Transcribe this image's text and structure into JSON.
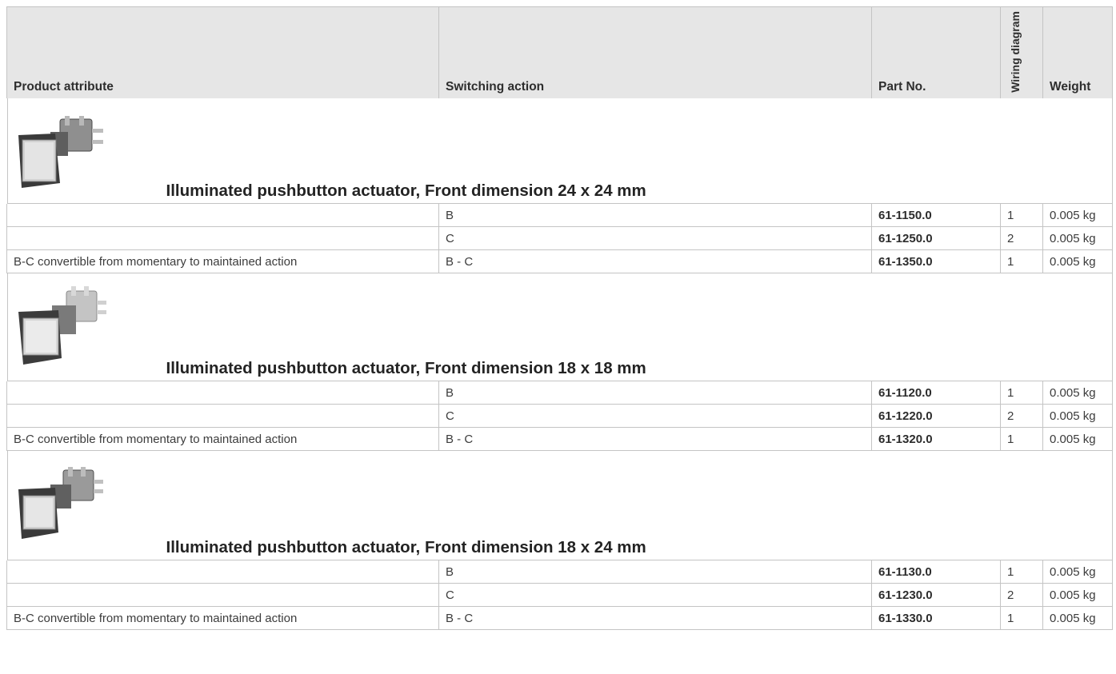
{
  "headers": {
    "product_attribute": "Product attribute",
    "switching_action": "Switching action",
    "part_no": "Part No.",
    "wiring_diagram": "Wiring diagram",
    "weight": "Weight"
  },
  "sections": [
    {
      "title": "Illuminated pushbutton actuator, Front dimension 24 x 24 mm",
      "rows": [
        {
          "attribute": "",
          "action": "B",
          "part_no": "61-1150.0",
          "wiring": "1",
          "weight": "0.005 kg"
        },
        {
          "attribute": "",
          "action": "C",
          "part_no": "61-1250.0",
          "wiring": "2",
          "weight": "0.005 kg"
        },
        {
          "attribute": "B-C convertible from momentary to maintained action",
          "action": "B - C",
          "part_no": "61-1350.0",
          "wiring": "1",
          "weight": "0.005 kg"
        }
      ]
    },
    {
      "title": "Illuminated pushbutton actuator, Front dimension 18 x 18 mm",
      "rows": [
        {
          "attribute": "",
          "action": "B",
          "part_no": "61-1120.0",
          "wiring": "1",
          "weight": "0.005 kg"
        },
        {
          "attribute": "",
          "action": "C",
          "part_no": "61-1220.0",
          "wiring": "2",
          "weight": "0.005 kg"
        },
        {
          "attribute": "B-C convertible from momentary to maintained action",
          "action": "B - C",
          "part_no": "61-1320.0",
          "wiring": "1",
          "weight": "0.005 kg"
        }
      ]
    },
    {
      "title": "Illuminated pushbutton actuator, Front dimension 18 x 24 mm",
      "rows": [
        {
          "attribute": "",
          "action": "B",
          "part_no": "61-1130.0",
          "wiring": "1",
          "weight": "0.005 kg"
        },
        {
          "attribute": "",
          "action": "C",
          "part_no": "61-1230.0",
          "wiring": "2",
          "weight": "0.005 kg"
        },
        {
          "attribute": "B-C convertible from momentary to maintained action",
          "action": "B - C",
          "part_no": "61-1330.0",
          "wiring": "1",
          "weight": "0.005 kg"
        }
      ]
    }
  ],
  "colors": {
    "header_bg": "#e6e6e6",
    "border": "#c4c4c4",
    "text": "#3c3c3c"
  }
}
